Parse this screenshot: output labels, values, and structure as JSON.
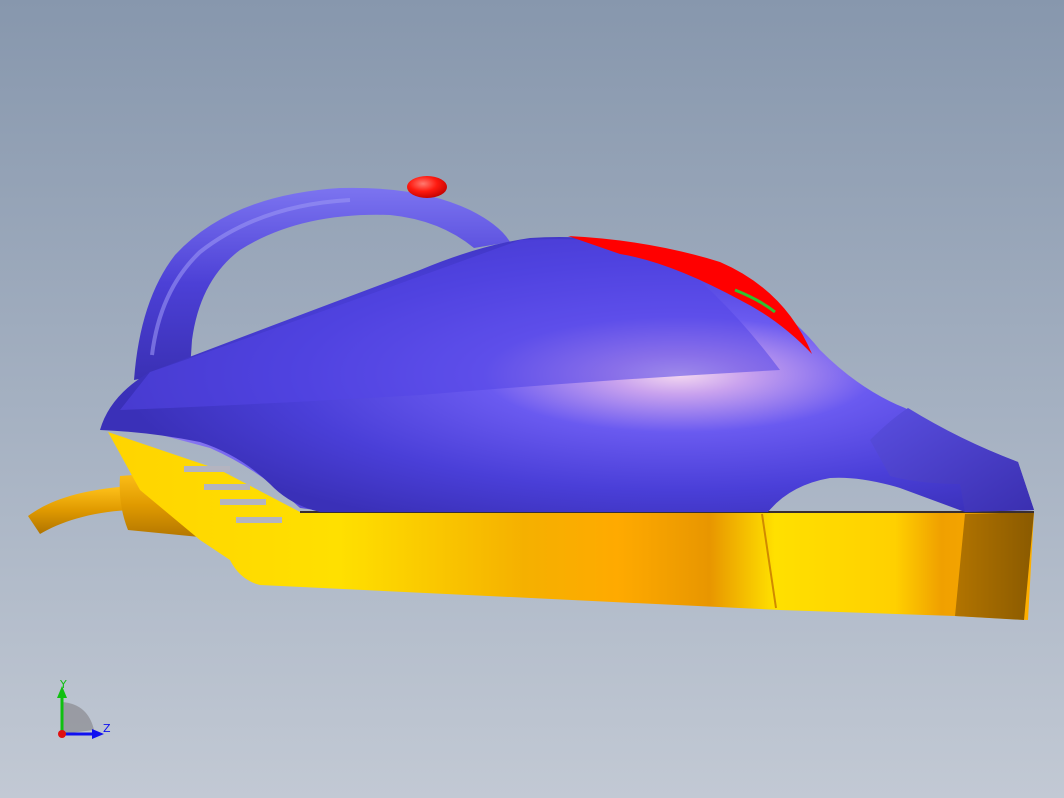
{
  "viewport": {
    "background_top": "#8797ad",
    "background_bottom": "#c2c9d4"
  },
  "model": {
    "body_color": "#5a4fe6",
    "base_color": "#f5b400",
    "button_color": "#ff1a10",
    "panel_color": "#ff0000",
    "vent_color": "#b4b4c0"
  },
  "triad": {
    "x_label": "",
    "y_label": "Y",
    "z_label": "Z",
    "y_color": "#10c010",
    "z_color": "#1010f0",
    "x_color": "#e01010"
  }
}
